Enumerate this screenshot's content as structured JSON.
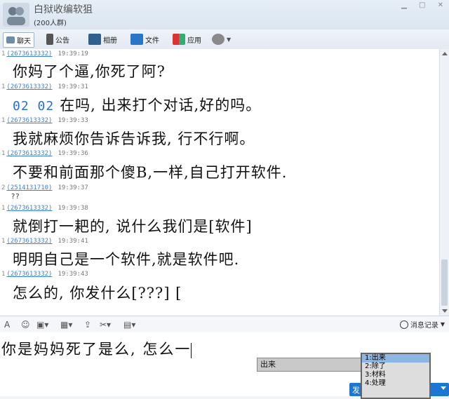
{
  "window": {
    "group_name": "白狱收编软狙",
    "group_count": "(200人群)",
    "ctrl_icons": [
      "minimize-icon",
      "maximize-icon",
      "close-icon"
    ]
  },
  "toolbar": {
    "chat": "聊天",
    "notice": "公告",
    "album": "相册",
    "file": "文件",
    "app": "应用"
  },
  "messages": [
    {
      "idx": "1",
      "uid": "(2673613332)",
      "time": "19:39:19",
      "text": "你妈了个逼,你死了阿?"
    },
    {
      "idx": "1",
      "uid": "(2673613332)",
      "time": "19:39:31",
      "emoji": "02  02",
      "text": "在吗, 出来打个对话,好的吗。"
    },
    {
      "idx": "1",
      "uid": "(2673613332)",
      "time": "19:39:33",
      "text": "我就麻烦你告诉告诉我, 行不行啊。"
    },
    {
      "idx": "1",
      "uid": "(2673613332)",
      "time": "19:39:36",
      "text": "不要和前面那个傻B,一样,自己打开软件."
    },
    {
      "idx": "2",
      "uid": "(2514131710)",
      "time": "19:39:37",
      "text": "??"
    },
    {
      "idx": "1",
      "uid": "(2673613332)",
      "time": "19:39:38",
      "text": "就倒打一耙的, 说什么我们是[软件]"
    },
    {
      "idx": "1",
      "uid": "(2673613332)",
      "time": "19:39:41",
      "text": "明明自己是一个软件,就是软件吧."
    },
    {
      "idx": "1",
      "uid": "(2673613332)",
      "time": "19:39:43",
      "text": "怎么的, 你发什么[???] ["
    }
  ],
  "input": {
    "text": "你是妈妈死了是么, 怎么一"
  },
  "history_label": "消息记录",
  "ime": {
    "composition": "出来",
    "candidates": [
      "1:出来",
      "2:除了",
      "3:材料",
      "4:处理"
    ]
  },
  "send": {
    "label": "发"
  }
}
